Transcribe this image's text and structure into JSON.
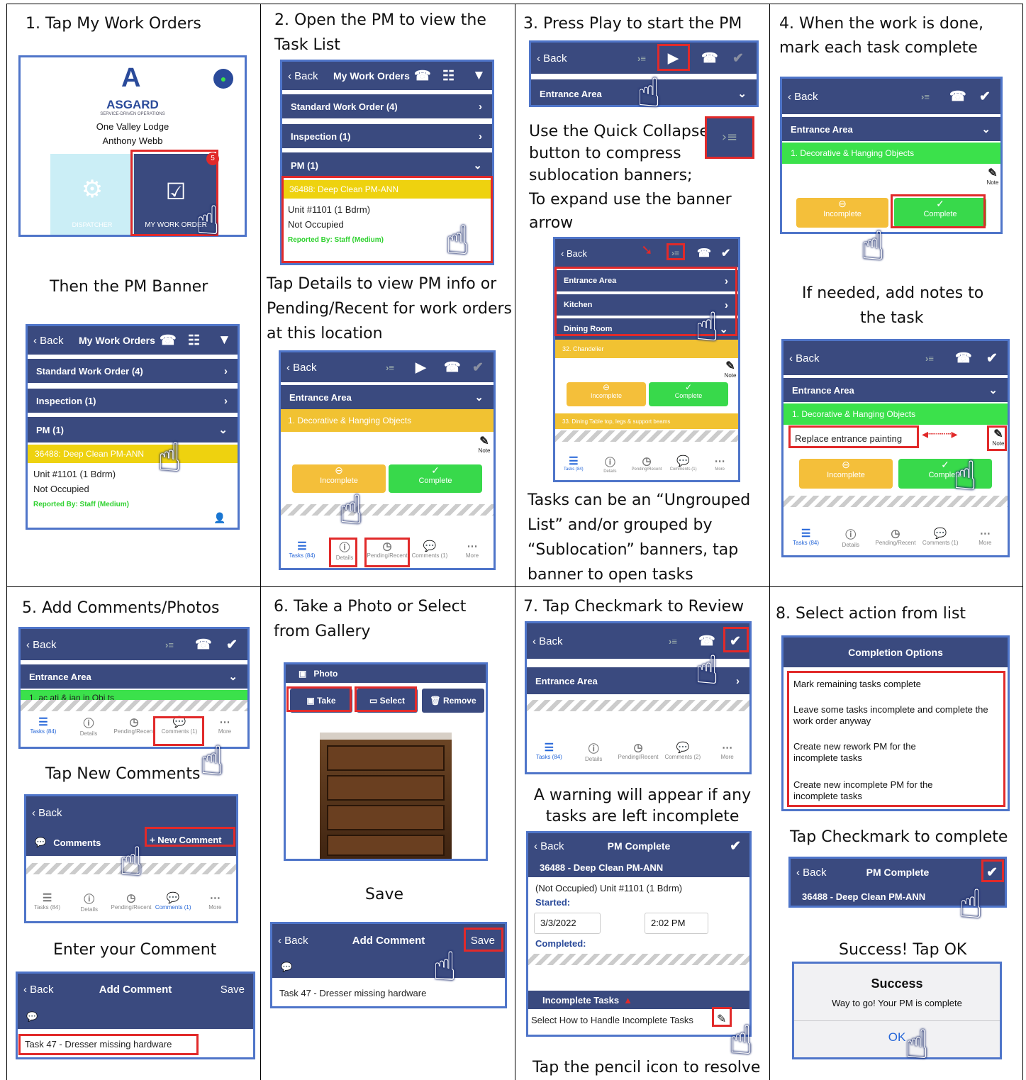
{
  "grid_colors": {
    "border": "#000000",
    "screen_frame": "#4f75c9",
    "highlight": "#e12a2a",
    "nav": "#3a4a7f",
    "yellow": "#f1c232",
    "green": "#38d94b",
    "link": "#2566d8"
  },
  "common": {
    "back": "Back",
    "my_work_orders": "My Work Orders",
    "standard_wo": "Standard Work Order (4)",
    "inspection": "Inspection (1)",
    "pm": "PM (1)",
    "pm_banner": "36488:  Deep Clean PM-ANN",
    "unit": "Unit #1101 (1 Bdrm)",
    "occupied": "Not Occupied",
    "reported": "Reported By: Staff  (Medium)",
    "entrance": "Entrance Area",
    "kitchen": "Kitchen",
    "dining": "Dining Room",
    "chandelier": "32.  Chandelier",
    "dining_table": "33.  Dining Table top, legs & support beams",
    "decorative": "1.  Decorative & Hanging Objects",
    "incomplete": "Incomplete",
    "complete": "Complete",
    "note": "Note",
    "tab_tasks": "Tasks (84)",
    "tab_details": "Details",
    "tab_pending": "Pending/Recent",
    "tab_comments1": "Comments (1)",
    "tab_comments2": "Comments (2)",
    "tab_more": "More",
    "add_comment": "Add Comment",
    "save": "Save",
    "comment_text": "Task 47 - Dresser missing hardware",
    "pm_complete": "PM Complete",
    "pm_id": "36488 - Deep Clean PM-ANN",
    "comments": "Comments",
    "new_comment": "+ New Comment",
    "decorative_cut": "1.  ac  ati  &  ian  in  Obj  ts"
  },
  "p1": {
    "step": "1. Tap My Work Orders",
    "company": "ASGARD",
    "tagline": "SERVICE-DRIVEN OPERATIONS",
    "property": "One Valley Lodge",
    "user": "Anthony Webb",
    "dispatcher": "DISPATCHER",
    "my_work_order": "MY WORK ORDER",
    "badge": "5",
    "then": "Then the PM Banner"
  },
  "p2": {
    "step_l1": "2. Open the PM to view the",
    "step_l2": "Task List",
    "tap_l1": "Tap Details to view PM info or",
    "tap_l2": "Pending/Recent for work orders",
    "tap_l3": "at this location"
  },
  "p3": {
    "step": "3. Press Play to start the PM",
    "qc_l1": "Use the Quick Collapse",
    "qc_l2": "button to compress",
    "qc_l3": "sublocation banners;",
    "qc_l4": "To expand use the banner",
    "qc_l5": "arrow",
    "tasks_l1": "Tasks can be an “Ungrouped",
    "tasks_l2": "List” and/or grouped by",
    "tasks_l3": "“Sublocation” banners, tap",
    "tasks_l4": "banner to open tasks"
  },
  "p4": {
    "step_l1": "4. When the work is done,",
    "step_l2": "mark each task complete",
    "notes_l1": "If needed, add notes to",
    "notes_l2": "the task",
    "note_text": "Replace entrance painting"
  },
  "p5": {
    "step": "5. Add Comments/Photos",
    "tap_new": "Tap New Comments",
    "enter": "Enter your Comment"
  },
  "p6": {
    "step_l1": "6. Take a Photo or Select",
    "step_l2": "from Gallery",
    "photo": "Photo",
    "take": "Take",
    "select": "Select",
    "remove": "Remove",
    "save_caption": "Save"
  },
  "p7": {
    "step": "7. Tap Checkmark to Review",
    "warn_l1": "A warning will appear if any",
    "warn_l2": "tasks are left incomplete",
    "not_occ_unit": "(Not Occupied)  Unit #1101 (1 Bdrm)",
    "started": "Started:",
    "date": "3/3/2022",
    "time": "2:02 PM",
    "completed": "Completed:",
    "incomplete_tasks": "Incomplete Tasks",
    "select_how": "Select How to Handle Incomplete Tasks",
    "pencil_caption": "Tap the pencil icon to resolve"
  },
  "p8": {
    "step": "8. Select action from list",
    "options_title": "Completion Options",
    "opt1": "Mark remaining tasks complete",
    "opt2": "Leave some tasks incomplete and complete the work order anyway",
    "opt3": "Create new rework PM for the incomplete tasks",
    "opt4": "Create new incomplete PM for the incomplete tasks",
    "tap_check": "Tap Checkmark to complete",
    "success_caption": "Success! Tap OK",
    "success_title": "Success",
    "success_msg": "Way to go! Your PM is complete",
    "ok": "OK"
  }
}
